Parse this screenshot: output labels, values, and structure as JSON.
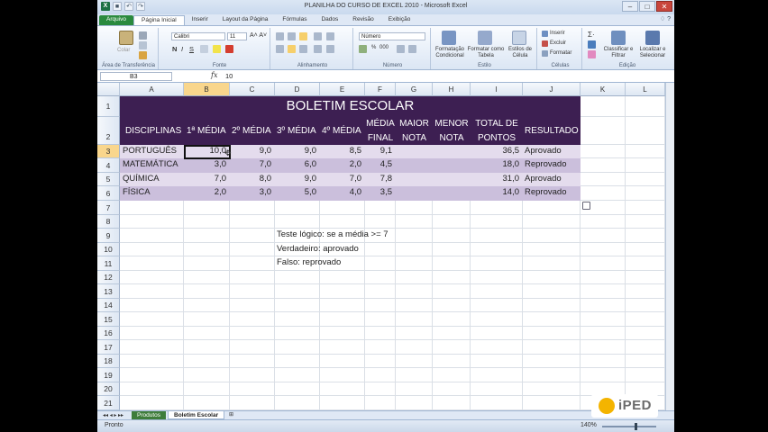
{
  "window": {
    "title": "PLANILHA DO CURSO DE EXCEL 2010  -  Microsoft Excel",
    "app_icon": "X",
    "controls": [
      "–",
      "□",
      "✕"
    ]
  },
  "tabs": [
    "Arquivo",
    "Página Inicial",
    "Inserir",
    "Layout da Página",
    "Fórmulas",
    "Dados",
    "Revisão",
    "Exibição"
  ],
  "ribbon": {
    "clipboard": {
      "label": "Área de Transferência",
      "paste": "Colar"
    },
    "font": {
      "label": "Fonte",
      "name": "Calibri",
      "size": "11",
      "bold": "N",
      "italic": "I",
      "underline": "S"
    },
    "alignment": {
      "label": "Alinhamento"
    },
    "number": {
      "label": "Número",
      "format": "Número",
      "currency": "%",
      "thousands": "000"
    },
    "styles": {
      "label": "Estilo",
      "cond": "Formatação Condicional",
      "table": "Formatar como Tabela",
      "cell": "Estilos de Célula"
    },
    "cells": {
      "label": "Células",
      "insert": "Inserir",
      "delete": "Excluir",
      "format": "Formatar"
    },
    "editing": {
      "label": "Edição",
      "sort": "Classificar e Filtrar",
      "find": "Localizar e Selecionar"
    }
  },
  "formula_bar": {
    "name_box": "B3",
    "fx": "fx",
    "value": "10"
  },
  "columns": [
    "A",
    "B",
    "C",
    "D",
    "E",
    "F",
    "G",
    "H",
    "I",
    "J",
    "K",
    "L"
  ],
  "rows": [
    "1",
    "2",
    "3",
    "4",
    "5",
    "6",
    "7",
    "8",
    "9",
    "10",
    "11",
    "12",
    "13",
    "14",
    "15",
    "16",
    "17",
    "18",
    "19",
    "20",
    "21"
  ],
  "sheet": {
    "title": "BOLETIM ESCOLAR",
    "headers": [
      "DISCIPLINAS",
      "1ª MÉDIA",
      "2º MÉDIA",
      "3º MÉDIA",
      "4º MÉDIA",
      "MÉDIA",
      "FINAL",
      "MAIOR",
      "NOTA",
      "MENOR",
      "NOTA",
      "TOTAL DE",
      "PONTOS",
      "RESULTADO"
    ],
    "data": [
      [
        "PORTUGUÊS",
        "10,0",
        "9,0",
        "9,0",
        "8,5",
        "9,1",
        "36,5",
        "Aprovado"
      ],
      [
        "MATEMÁTICA",
        "3,0",
        "7,0",
        "6,0",
        "2,0",
        "4,5",
        "18,0",
        "Reprovado"
      ],
      [
        "QUÍMICA",
        "7,0",
        "8,0",
        "9,0",
        "7,0",
        "7,8",
        "31,0",
        "Aprovado"
      ],
      [
        "FÍSICA",
        "2,0",
        "3,0",
        "5,0",
        "4,0",
        "3,5",
        "14,0",
        "Reprovado"
      ]
    ],
    "notes": [
      "Teste lógico: se a média >= 7",
      "Verdadeiro: aprovado",
      "Falso: reprovado"
    ]
  },
  "sheet_tabs": [
    "Produtos",
    "Boletim Escolar"
  ],
  "status": {
    "ready": "Pronto",
    "zoom": "140%"
  },
  "logo": {
    "small": "Cursos",
    "name": "iPED"
  },
  "colors": {
    "header_dark": "#3d1f52",
    "band_light": "#e4dced",
    "band_mid": "#cbbfdc",
    "file_tab": "#2a8a3e"
  }
}
